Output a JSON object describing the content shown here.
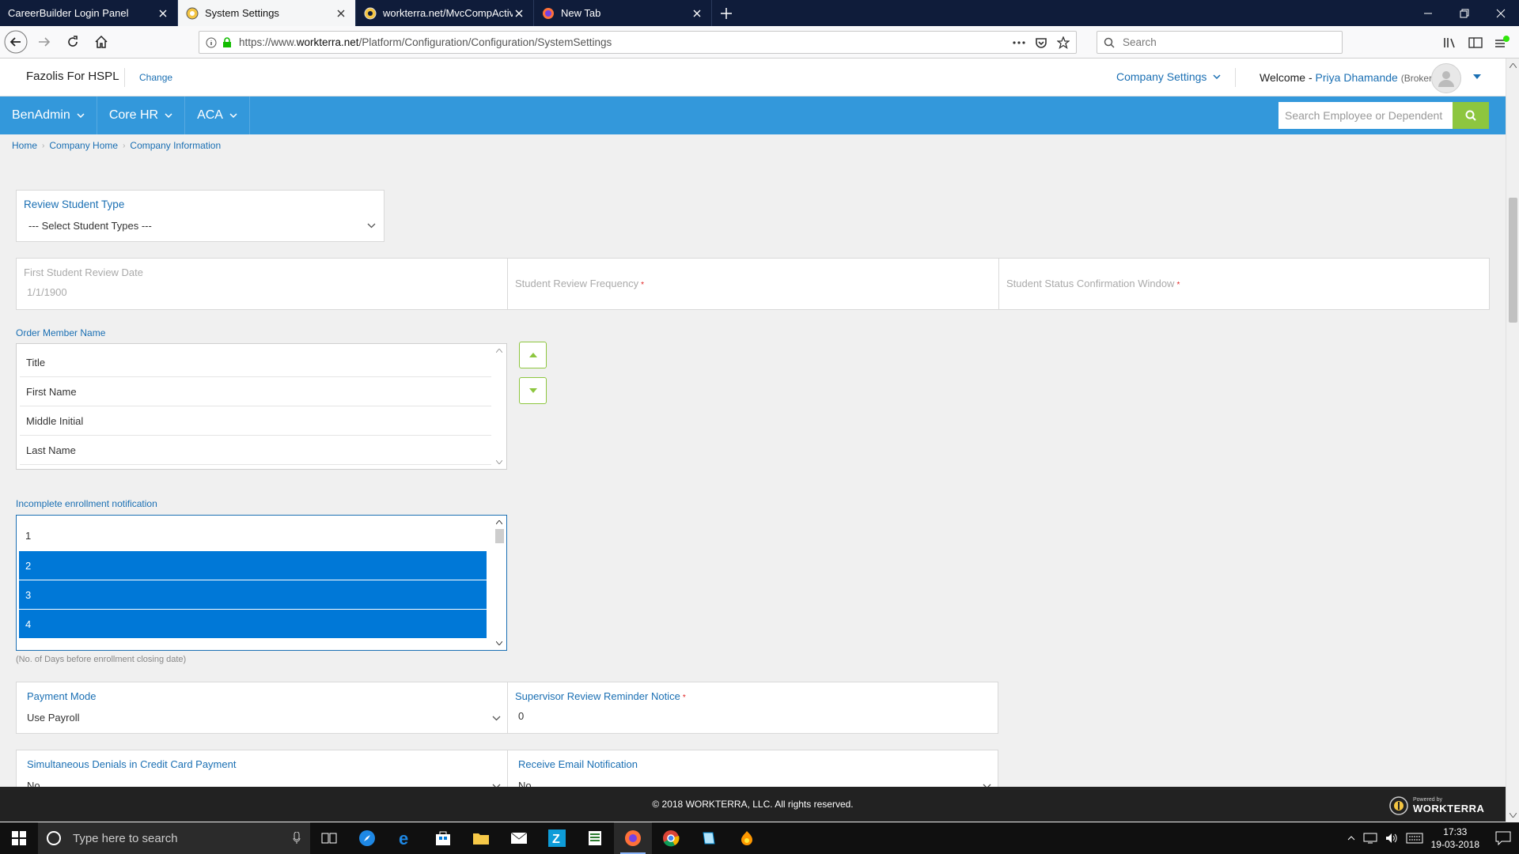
{
  "browser": {
    "tabs": [
      {
        "title": "CareerBuilder Login Panel"
      },
      {
        "title": "System Settings"
      },
      {
        "title": "workterra.net/MvcCompActiv"
      },
      {
        "title": "New Tab"
      }
    ],
    "url_prefix": "https://www.",
    "url_domain": "workterra.net",
    "url_path": "/Platform/Configuration/Configuration/SystemSettings",
    "search_placeholder": "Search"
  },
  "header": {
    "company": "Fazolis For HSPL",
    "change": "Change",
    "company_settings": "Company Settings",
    "welcome": "Welcome -",
    "user": "Priya Dhamande",
    "role": "(Broker)"
  },
  "menu": {
    "items": [
      {
        "label": "BenAdmin"
      },
      {
        "label": "Core HR"
      },
      {
        "label": "ACA"
      }
    ],
    "search_placeholder": "Search Employee or Dependent"
  },
  "breadcrumb": [
    "Home",
    "Company Home",
    "Company Information"
  ],
  "form": {
    "review_student_type": {
      "label": "Review Student Type",
      "value": "--- Select Student Types ---"
    },
    "first_review_date": {
      "label": "First Student Review Date",
      "value": "1/1/1900"
    },
    "review_frequency": {
      "label": "Student Review Frequency",
      "req": "*"
    },
    "status_window": {
      "label": "Student Status Confirmation Window",
      "req": "*"
    },
    "order_member": {
      "label": "Order Member Name",
      "items": [
        "Title",
        "First Name",
        "Middle Initial",
        "Last Name"
      ]
    },
    "incomplete_notify": {
      "label": "Incomplete enrollment notification",
      "items": [
        "1",
        "2",
        "3",
        "4"
      ],
      "hint": "(No. of Days before enrollment closing date)"
    },
    "payment_mode": {
      "label": "Payment Mode",
      "value": "Use Payroll"
    },
    "supervisor_notice": {
      "label": "Supervisor Review Reminder Notice",
      "req": "*",
      "value": "0"
    },
    "simultaneous_denials": {
      "label": "Simultaneous Denials in Credit Card Payment",
      "value": "No"
    },
    "receive_email": {
      "label": "Receive Email Notification",
      "value": "No"
    }
  },
  "footer": {
    "copyright": "© 2018 WORKTERRA, LLC. All rights reserved.",
    "powered_by": "Powered by",
    "brand": "WORKTERRA"
  },
  "taskbar": {
    "search_placeholder": "Type here to search",
    "time": "17:33",
    "date": "19-03-2018"
  },
  "colors": {
    "menu_blue": "#3398db",
    "accent_green": "#8dc63f",
    "link_blue": "#1a6fb3",
    "selection_blue": "#0078d7"
  }
}
